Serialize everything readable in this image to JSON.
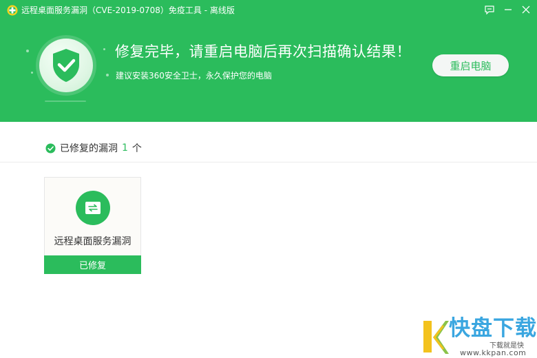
{
  "window": {
    "title": "远程桌面服务漏洞（CVE-2019-0708）免疫工具 - 离线版"
  },
  "result": {
    "headline": "修复完毕，请重启电脑后再次扫描确认结果！",
    "subline": "建议安装360安全卫士，永久保护您的电脑",
    "restart_label": "重启电脑"
  },
  "summary": {
    "prefix": "已修复的漏洞",
    "count": "1",
    "suffix": "个"
  },
  "vulnerabilities": [
    {
      "name": "远程桌面服务漏洞",
      "status": "已修复"
    }
  ],
  "watermark": {
    "brand": "快盘下载",
    "tagline": "下载就是快",
    "url": "www.kkpan.com"
  },
  "colors": {
    "primary_green": "#2bbc5c",
    "watermark_blue": "#3aa6e0"
  },
  "icons": {
    "app": "app-logo-icon",
    "feedback": "feedback-icon",
    "minimize": "minimize-icon",
    "close": "close-icon",
    "shield": "shield-check-icon",
    "check": "check-circle-icon",
    "vuln": "transfer-icon"
  }
}
